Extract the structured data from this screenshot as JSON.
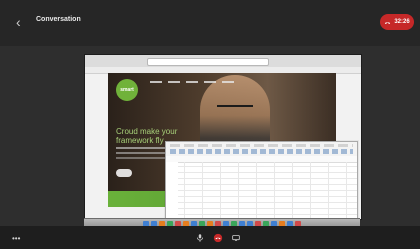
{
  "topbar": {
    "title": "Conversation",
    "end_call_label": "32:26"
  },
  "shared_screen": {
    "website": {
      "logo_text": "smart",
      "headline": "Croud make your framework fly"
    }
  },
  "icons": {
    "back": "chevron-left-icon",
    "end_call": "phone-hangup-icon",
    "more": "more-icon",
    "mute": "microphone-icon",
    "video": "camera-icon",
    "screen_share": "screen-share-icon"
  },
  "colors": {
    "end_call": "#c62828",
    "topbar": "#262626",
    "stage": "#2e2e2e",
    "bottombar": "#1e1e1e",
    "site_green": "#64a834"
  }
}
